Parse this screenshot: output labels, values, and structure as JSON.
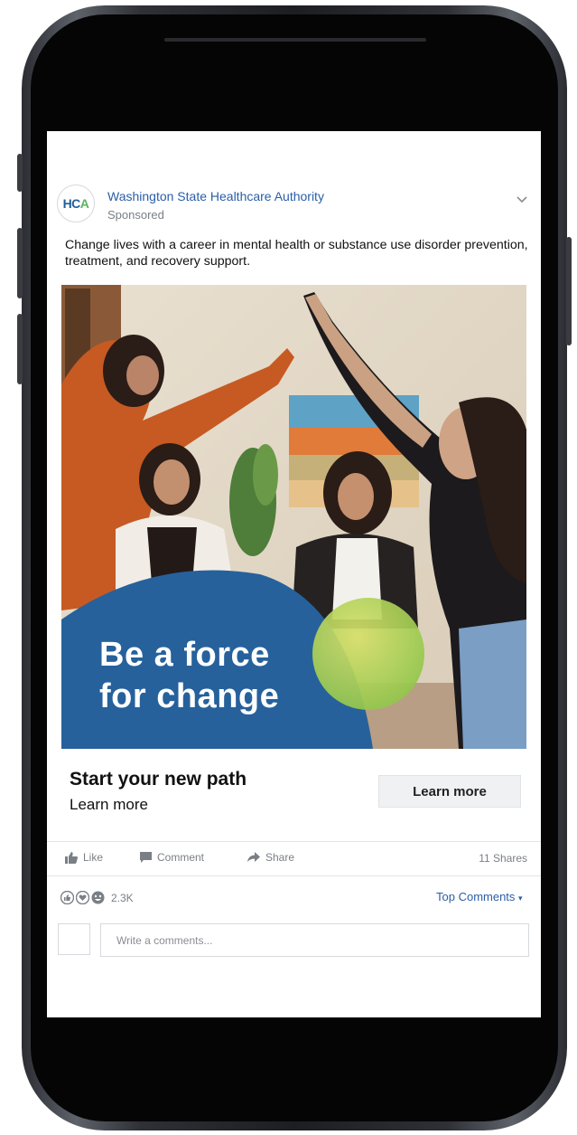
{
  "post": {
    "page_name": "Washington State Healthcare Authority",
    "logo_text_a": "HC",
    "logo_text_b": "A",
    "sponsored": "Sponsored",
    "body": "Change lives with a career in mental health or substance use disorder prevention, treatment, and recovery support.",
    "headline_line1": "Be a force",
    "headline_line2": "for change"
  },
  "cta": {
    "title": "Start your new path",
    "subtitle": "Learn more",
    "button_label": "Learn more"
  },
  "actions": {
    "like": "Like",
    "comment": "Comment",
    "share": "Share",
    "shares_count": "11 Shares"
  },
  "reactions": {
    "count": "2.3K",
    "top_comments": "Top Comments"
  },
  "comment_box": {
    "placeholder": "Write a comments..."
  },
  "colors": {
    "brand_blue": "#2a5ea8",
    "ad_blue": "#26619c",
    "ad_green": "#b6d24a"
  }
}
